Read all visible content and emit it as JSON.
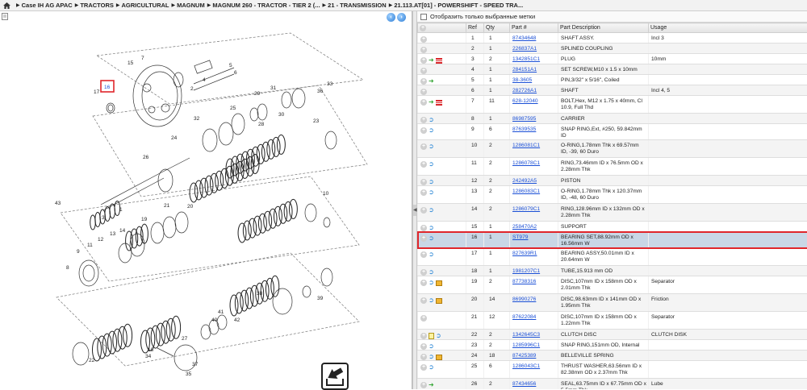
{
  "breadcrumb": [
    "Case IH AG APAC",
    "TRACTORS",
    "AGRICULTURAL",
    "MAGNUM",
    "MAGNUM 260 - TRACTOR - TIER 2 (...",
    "21 - TRANSMISSION",
    "21.113.AT[01] - POWERSHIFT - SPEED TRA..."
  ],
  "diagram": {
    "highlighted_ref": "16",
    "callouts": [
      "1",
      "2",
      "3",
      "4",
      "5",
      "6",
      "7",
      "8",
      "9",
      "10",
      "11",
      "12",
      "13",
      "14",
      "15",
      "16",
      "17",
      "18",
      "19",
      "20",
      "21",
      "22",
      "23",
      "24",
      "25",
      "26",
      "27",
      "28",
      "29",
      "30",
      "31",
      "32",
      "33",
      "34",
      "35",
      "36",
      "37",
      "38",
      "39",
      "40",
      "41",
      "42",
      "43"
    ]
  },
  "filter_label": "Отобразить только выбранные метки",
  "columns": {
    "ref": "Ref",
    "qty": "Qty",
    "part": "Part #",
    "desc": "Part Description",
    "usage": "Usage"
  },
  "colors": {
    "link": "#1a4fd6",
    "highlight": "#e0262b",
    "selected_row": "#c9d7e6"
  },
  "rows": [
    {
      "ref": "1",
      "qty": "1",
      "part": "87434648",
      "desc": "SHAFT ASSY.",
      "usage": "Incl 3",
      "icons": []
    },
    {
      "ref": "2",
      "qty": "1",
      "part": "226837A1",
      "desc": "SPLINED COUPLING",
      "usage": "",
      "icons": []
    },
    {
      "ref": "3",
      "qty": "2",
      "part": "1342851C1",
      "desc": "PLUG",
      "usage": "10mm",
      "icons": [
        "green",
        "red"
      ]
    },
    {
      "ref": "4",
      "qty": "1",
      "part": "284151A1",
      "desc": "SET SCREW,M10 x 1.5 x 10mm",
      "usage": "",
      "icons": []
    },
    {
      "ref": "5",
      "qty": "1",
      "part": "38-3605",
      "desc": "PIN,3/32\" x 5/16\", Coiled",
      "usage": "",
      "icons": [
        "green"
      ]
    },
    {
      "ref": "6",
      "qty": "1",
      "part": "282726A1",
      "desc": "SHAFT",
      "usage": "Incl 4, 5",
      "icons": []
    },
    {
      "ref": "7",
      "qty": "11",
      "part": "628-12040",
      "desc": "BOLT,Hex, M12 x 1.75 x 40mm, Cl 10.9, Full Thd",
      "usage": "",
      "icons": [
        "green",
        "red"
      ]
    },
    {
      "ref": "8",
      "qty": "1",
      "part": "86987595",
      "desc": "CARRIER",
      "usage": "",
      "icons": [
        "blue"
      ]
    },
    {
      "ref": "9",
      "qty": "6",
      "part": "87639535",
      "desc": "SNAP RING,Ext, #250, 59.842mm ID",
      "usage": "",
      "icons": [
        "blue"
      ]
    },
    {
      "ref": "10",
      "qty": "2",
      "part": "1286081C1",
      "desc": "O-RING,1.78mm Thk x 69.57mm ID, -39, 60 Duro",
      "usage": "",
      "icons": [
        "blue"
      ]
    },
    {
      "ref": "11",
      "qty": "2",
      "part": "1286078C1",
      "desc": "RING,73.46mm ID x 76.5mm OD x 2.28mm Thk",
      "usage": "",
      "icons": [
        "blue"
      ]
    },
    {
      "ref": "12",
      "qty": "2",
      "part": "242492A5",
      "desc": "PISTON",
      "usage": "",
      "icons": [
        "blue"
      ]
    },
    {
      "ref": "13",
      "qty": "2",
      "part": "1286083C1",
      "desc": "O-RING,1.78mm Thk x 120.37mm ID, -48, 60 Duro",
      "usage": "",
      "icons": [
        "blue"
      ]
    },
    {
      "ref": "14",
      "qty": "2",
      "part": "1286079C1",
      "desc": "RING,128.96mm ID x 132mm OD x 2.28mm Thk",
      "usage": "",
      "icons": [
        "blue"
      ]
    },
    {
      "ref": "15",
      "qty": "1",
      "part": "258470A2",
      "desc": "SUPPORT",
      "usage": "",
      "icons": [
        "blue"
      ]
    },
    {
      "ref": "16",
      "qty": "1",
      "part": "ST979",
      "desc": "BEARING SET,88.92mm OD x 16.56mm W",
      "usage": "",
      "icons": [
        "blue"
      ],
      "selected": true
    },
    {
      "ref": "17",
      "qty": "1",
      "part": "827639R1",
      "desc": "BEARING ASSY,50.01mm ID x 20.64mm W",
      "usage": "",
      "icons": [
        "blue"
      ]
    },
    {
      "ref": "18",
      "qty": "1",
      "part": "1981207C1",
      "desc": "TUBE,15.913 mm OD",
      "usage": "",
      "icons": [
        "blue"
      ]
    },
    {
      "ref": "19",
      "qty": "2",
      "part": "87738316",
      "desc": "DISC,107mm ID x 158mm OD x 2.01mm Thk",
      "usage": "Separator",
      "icons": [
        "blue",
        "box"
      ]
    },
    {
      "ref": "20",
      "qty": "14",
      "part": "86990276",
      "desc": "DISC,98.63mm ID x 141mm OD x 1.95mm Thk",
      "usage": "Friction",
      "icons": [
        "blue",
        "box"
      ]
    },
    {
      "ref": "21",
      "qty": "12",
      "part": "87622084",
      "desc": "DISC,107mm ID x 158mm OD x 1.22mm Thk",
      "usage": "Separator",
      "icons": []
    },
    {
      "ref": "22",
      "qty": "2",
      "part": "1342645C3",
      "desc": "CLUTCH DISC",
      "usage": "CLUTCH DISK",
      "icons": [
        "note",
        "blue"
      ]
    },
    {
      "ref": "23",
      "qty": "2",
      "part": "1285996C1",
      "desc": "SNAP RING,151mm OD, Internal",
      "usage": "",
      "icons": [
        "blue"
      ]
    },
    {
      "ref": "24",
      "qty": "18",
      "part": "87425389",
      "desc": "BELLEVILLE SPRING",
      "usage": "",
      "icons": [
        "blue",
        "box"
      ]
    },
    {
      "ref": "25",
      "qty": "6",
      "part": "1286043C1",
      "desc": "THRUST WASHER,63.56mm ID x 82.38mm OD x 2.37mm Thk",
      "usage": "",
      "icons": [
        "blue"
      ]
    },
    {
      "ref": "26",
      "qty": "2",
      "part": "87434656",
      "desc": "SEAL,63.75mm ID x 67.75mm OD x 5.5mm Thk",
      "usage": "Lube",
      "icons": [
        "green"
      ]
    }
  ]
}
